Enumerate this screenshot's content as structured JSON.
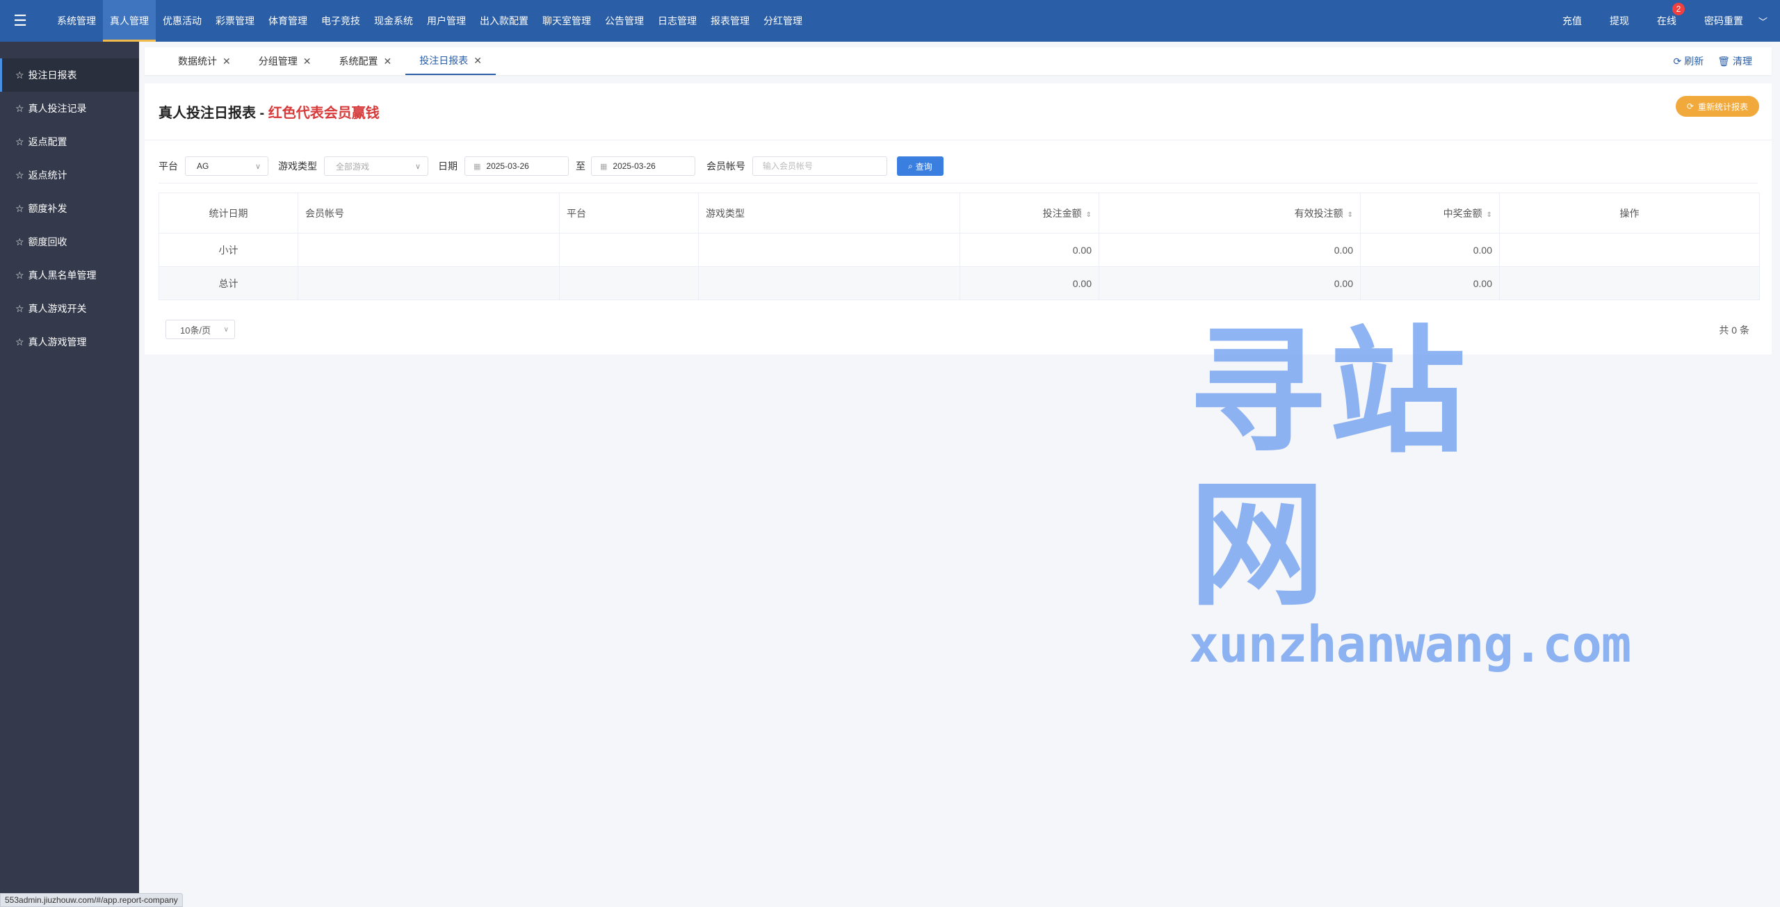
{
  "topnav": {
    "items": [
      "系统管理",
      "真人管理",
      "优惠活动",
      "彩票管理",
      "体育管理",
      "电子竞技",
      "现金系统",
      "用户管理",
      "出入款配置",
      "聊天室管理",
      "公告管理",
      "日志管理",
      "报表管理",
      "分红管理"
    ],
    "active_index": 1,
    "right": {
      "recharge": "充值",
      "withdraw": "提现",
      "online": "在线",
      "online_count": "2",
      "reset_password": "密码重置"
    }
  },
  "sidebar": {
    "items": [
      "投注日报表",
      "真人投注记录",
      "返点配置",
      "返点统计",
      "额度补发",
      "额度回收",
      "真人黑名单管理",
      "真人游戏开关",
      "真人游戏管理"
    ],
    "active_index": 0
  },
  "tabs": {
    "items": [
      "数据统计",
      "分组管理",
      "系统配置",
      "投注日报表"
    ],
    "active_index": 3,
    "refresh": "刷新",
    "clear": "清理"
  },
  "page": {
    "title": "真人投注日报表 - ",
    "title_highlight": "红色代表会员赢钱",
    "recalc_button": "重新统计报表"
  },
  "filters": {
    "platform_label": "平台",
    "platform_value": "AG",
    "game_type_label": "游戏类型",
    "game_type_placeholder": "全部游戏",
    "date_label": "日期",
    "date_from": "2025-03-26",
    "date_to_label": "至",
    "date_to": "2025-03-26",
    "member_label": "会员帐号",
    "member_placeholder": "输入会员帐号",
    "search_button": "查询"
  },
  "table": {
    "headers": [
      "统计日期",
      "会员帐号",
      "平台",
      "游戏类型",
      "投注金额",
      "有效投注额",
      "中奖金额",
      "操作"
    ],
    "rows": [
      {
        "date": "小计",
        "member": "",
        "platform": "",
        "game_type": "",
        "bet": "0.00",
        "valid_bet": "0.00",
        "win": "0.00",
        "action": ""
      },
      {
        "date": "总计",
        "member": "",
        "platform": "",
        "game_type": "",
        "bet": "0.00",
        "valid_bet": "0.00",
        "win": "0.00",
        "action": ""
      }
    ]
  },
  "pagination": {
    "page_size": "10条/页",
    "total": "共 0 条"
  },
  "watermark": {
    "big": "寻站网",
    "small": "xunzhanwang.com"
  },
  "status_url": "553admin.jiuzhouw.com/#/app.report-company",
  "colors": {
    "topbar": "#2a5ea7",
    "sidebar": "#343a4b",
    "accent_orange": "#f2a93b",
    "highlight_red": "#d83a3a",
    "primary_blue": "#3a7fe0"
  }
}
